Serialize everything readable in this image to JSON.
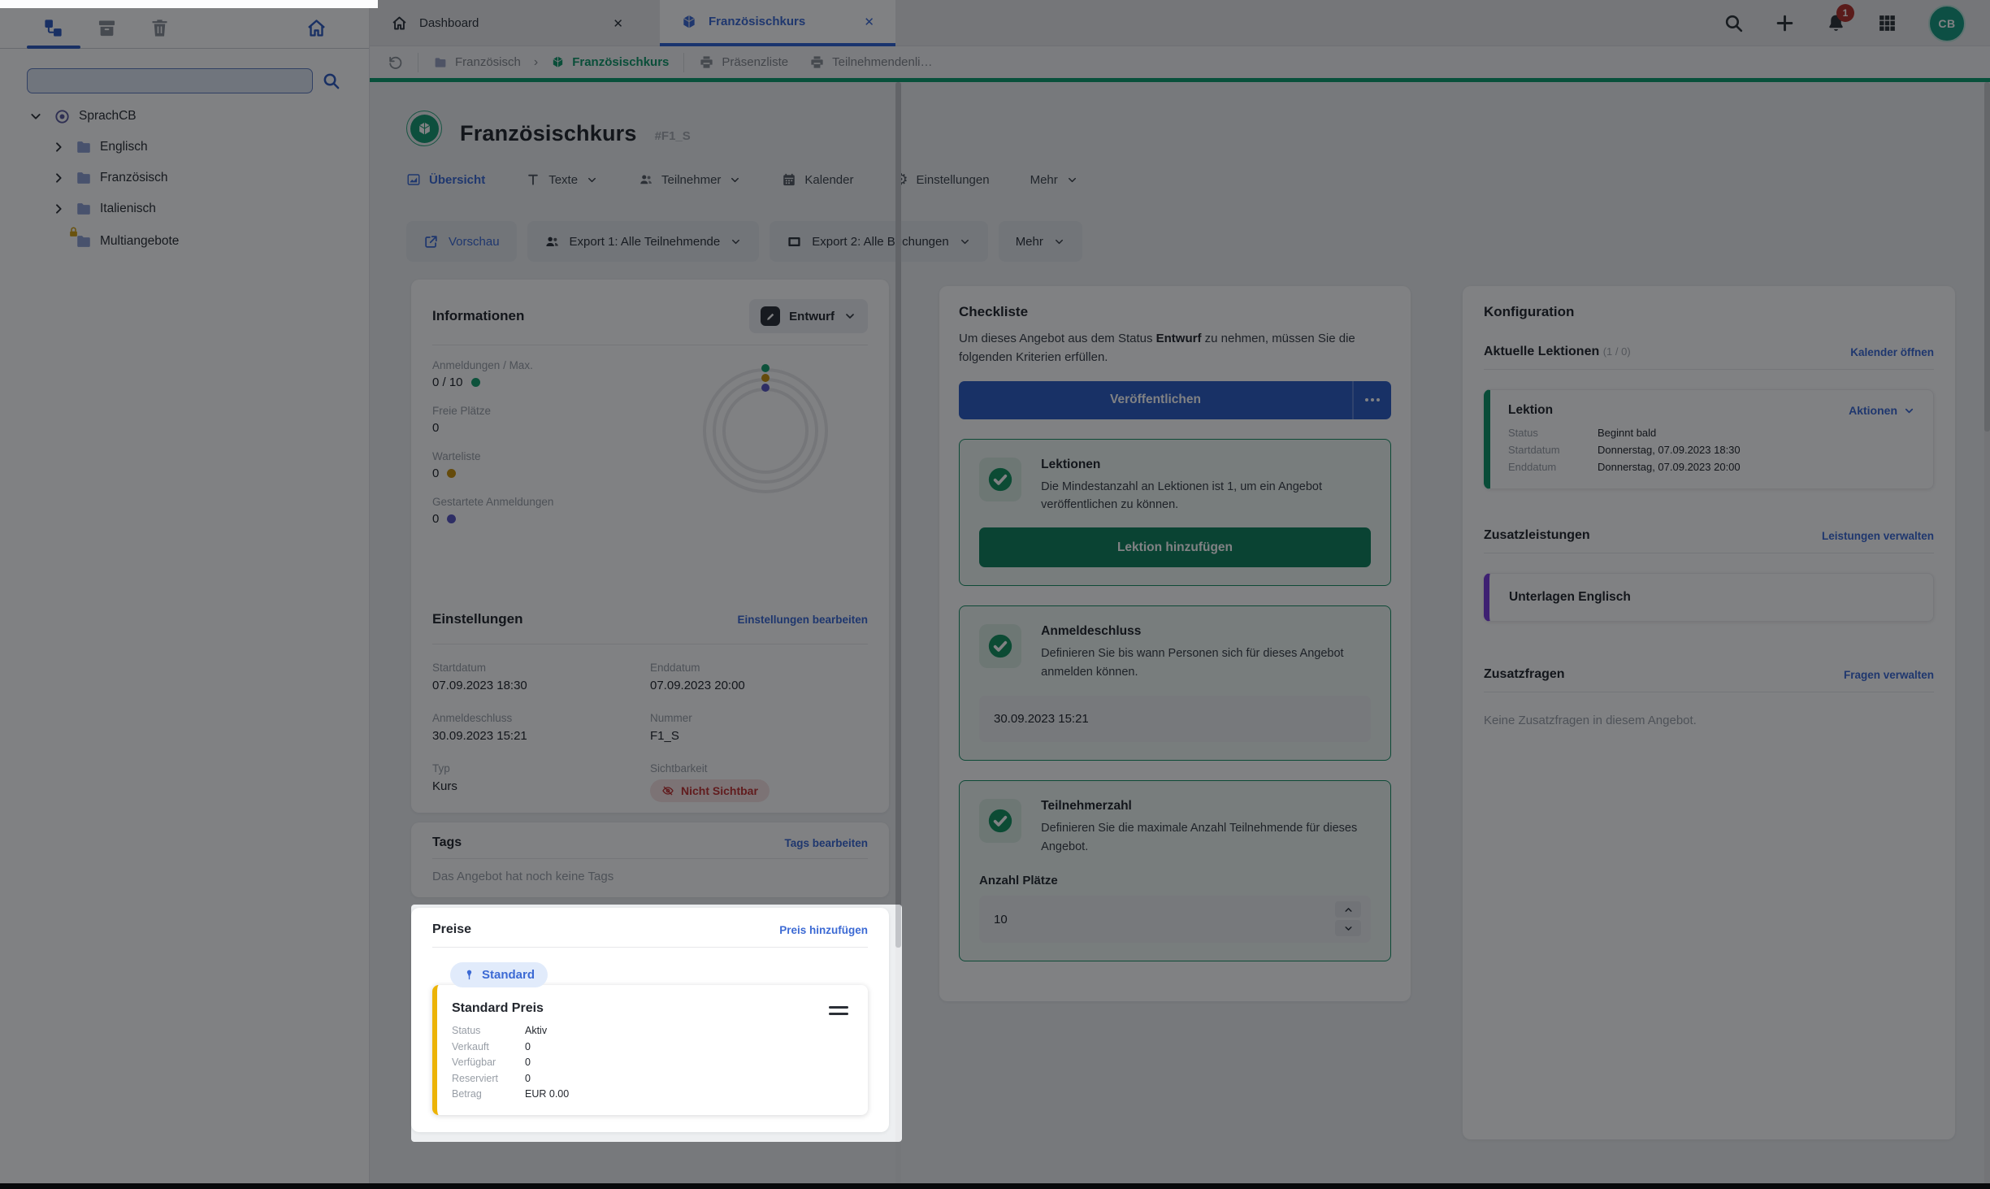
{
  "colors": {
    "accent_blue": "#3c6ad4",
    "green_accent": "#0e9d6d",
    "publish_blue": "#2e5ec4",
    "action_green": "#11835d",
    "check_green": "#15925f",
    "red_badge": "#c03434",
    "amber_dot": "#c9920e",
    "indigo_dot": "#5a57c2",
    "yellow_border": "#ecb306",
    "purple_border": "#7a3bdc",
    "teal_border": "#0f9468",
    "avatar_teal": "#189a80",
    "notification_red": "#b3322b"
  },
  "sidebar": {
    "search": {
      "value": "",
      "placeholder": ""
    },
    "tree": {
      "root": {
        "label": "SprachCB"
      },
      "items": [
        {
          "label": "Englisch"
        },
        {
          "label": "Französisch"
        },
        {
          "label": "Italienisch"
        },
        {
          "label": "Multiangebote"
        }
      ]
    }
  },
  "tabbar": {
    "tabs": [
      {
        "label": "Dashboard",
        "close": "✕"
      },
      {
        "label": "Französischkurs",
        "close": "✕"
      }
    ],
    "notification_count": "1",
    "avatar": "CB"
  },
  "breadcrumb": {
    "folder": "Französisch",
    "separator": "›",
    "current": "Französischkurs",
    "print_links": [
      "Präsenzliste",
      "Teilnehmendenli…"
    ]
  },
  "offer": {
    "title": "Französischkurs",
    "code": "#F1_S"
  },
  "nav": {
    "tabs": [
      {
        "label": "Übersicht"
      },
      {
        "label": "Texte"
      },
      {
        "label": "Teilnehmer"
      },
      {
        "label": "Kalender"
      },
      {
        "label": "Einstellungen"
      },
      {
        "label": "Mehr"
      }
    ]
  },
  "actions": {
    "vorschau": "Vorschau",
    "export1": "Export 1: Alle Teilnehmende",
    "export2": "Export 2: Alle Buchungen",
    "mehr": "Mehr"
  },
  "informationen": {
    "title": "Informationen",
    "status_button": "Entwurf",
    "stats": [
      {
        "label": "Anmeldungen / Max.",
        "value": "0 / 10"
      },
      {
        "label": "Freie Plätze",
        "value": "0"
      },
      {
        "label": "Warteliste",
        "value": "0"
      },
      {
        "label": "Gestartete Anmeldungen",
        "value": "0"
      }
    ],
    "einstellungen": {
      "title": "Einstellungen",
      "edit_link": "Einstellungen bearbeiten",
      "fields": [
        {
          "label": "Startdatum",
          "value": "07.09.2023 18:30"
        },
        {
          "label": "Enddatum",
          "value": "07.09.2023 20:00"
        },
        {
          "label": "Anmeldeschluss",
          "value": "30.09.2023 15:21"
        },
        {
          "label": "Nummer",
          "value": "F1_S"
        },
        {
          "label": "Typ",
          "value": "Kurs"
        },
        {
          "label": "Sichtbarkeit",
          "value": "Nicht Sichtbar"
        }
      ]
    }
  },
  "tags": {
    "title": "Tags",
    "edit_link": "Tags bearbeiten",
    "empty_text": "Das Angebot hat noch keine Tags"
  },
  "preise": {
    "title": "Preise",
    "add_link": "Preis hinzufügen",
    "badge": "Standard",
    "card": {
      "title": "Standard Preis",
      "rows": [
        {
          "label": "Status",
          "value": "Aktiv"
        },
        {
          "label": "Verkauft",
          "value": "0"
        },
        {
          "label": "Verfügbar",
          "value": "0"
        },
        {
          "label": "Reserviert",
          "value": "0"
        },
        {
          "label": "Betrag",
          "value": "EUR 0.00"
        }
      ]
    }
  },
  "checkliste": {
    "title": "Checkliste",
    "intro_before": "Um dieses Angebot aus dem Status ",
    "intro_bold": "Entwurf",
    "intro_after": " zu nehmen, müssen Sie die folgenden Kriterien erfüllen.",
    "publish_button": "Veröffentlichen",
    "cards": [
      {
        "title": "Lektionen",
        "description": "Die Mindestanzahl an Lektionen ist 1, um ein Angebot veröffentlichen zu können.",
        "action": "Lektion hinzufügen"
      },
      {
        "title": "Anmeldeschluss",
        "description": "Definieren Sie bis wann Personen sich für dieses Angebot anmelden können.",
        "input_value": "30.09.2023 15:21"
      },
      {
        "title": "Teilnehmerzahl",
        "description": "Definieren Sie die maximale Anzahl Teilnehmende für dieses Angebot.",
        "input_label": "Anzahl Plätze",
        "input_value": "10"
      }
    ]
  },
  "konfiguration": {
    "title": "Konfiguration",
    "aktuelle_lektionen": {
      "title": "Aktuelle Lektionen",
      "count": "(1 / 0)",
      "link": "Kalender öffnen",
      "card": {
        "title": "Lektion",
        "action": "Aktionen",
        "rows": [
          {
            "label": "Status",
            "value": "Beginnt bald"
          },
          {
            "label": "Startdatum",
            "value": "Donnerstag, 07.09.2023 18:30"
          },
          {
            "label": "Enddatum",
            "value": "Donnerstag, 07.09.2023 20:00"
          }
        ]
      }
    },
    "zusatzleistungen": {
      "title": "Zusatzleistungen",
      "link": "Leistungen verwalten",
      "card_title": "Unterlagen Englisch"
    },
    "zusatzfragen": {
      "title": "Zusatzfragen",
      "link": "Fragen verwalten",
      "empty_text": "Keine Zusatzfragen in diesem Angebot."
    }
  }
}
